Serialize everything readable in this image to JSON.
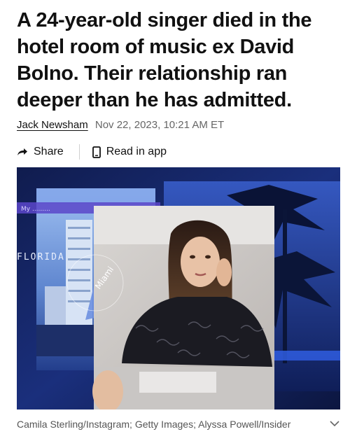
{
  "article": {
    "headline": "A 24-year-old singer died in the hotel room of music ex David Bolno. Their relationship ran deeper than he has admitted.",
    "author": "Jack Newsham",
    "date": "Nov 22, 2023, 10:21 AM ET"
  },
  "actions": {
    "share_label": "Share",
    "share_icon": "share-arrow-icon",
    "read_label": "Read in app",
    "read_icon": "phone-icon"
  },
  "image": {
    "overlay_text_left": "FLORIDA",
    "overlay_text_circle": "Miami",
    "overlay_strip_text": "My ........."
  },
  "caption": {
    "text": "Camila Sterling/Instagram; Getty Images; Alyssa Powell/Insider",
    "expand_icon": "chevron-down-icon"
  },
  "colors": {
    "text": "#111111",
    "muted": "#666666",
    "collage_blue": "#1f3fa8"
  }
}
